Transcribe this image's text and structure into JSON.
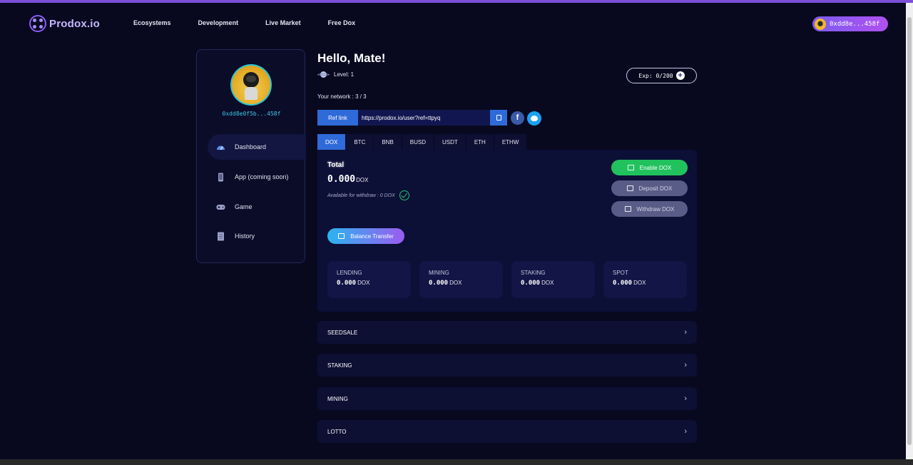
{
  "nav": {
    "logo_text": "Prodox.io",
    "links": [
      "Ecosystems",
      "Development",
      "Live Market",
      "Free Dox"
    ],
    "wallet_address": "0xdd8e...458f"
  },
  "sidebar": {
    "address": "0xdd8e0f5b...458f",
    "items": [
      {
        "label": "Dashboard",
        "icon": "gauge-icon"
      },
      {
        "label": "App (coming soon)",
        "icon": "phone-icon"
      },
      {
        "label": "Game",
        "icon": "gamepad-icon"
      },
      {
        "label": "History",
        "icon": "document-icon"
      }
    ]
  },
  "main": {
    "greeting": "Hello, Mate!",
    "level": "Level: 1",
    "exp": "Exp: 0/200",
    "network": "Your network : 3 / 3",
    "ref_label": "Ref link",
    "ref_value": "https://prodox.io/user?ref=ttpyq"
  },
  "tabs": [
    "DOX",
    "BTC",
    "BNB",
    "BUSD",
    "USDT",
    "ETH",
    "ETHW"
  ],
  "balance": {
    "total_label": "Total",
    "total_value": "0.000",
    "total_unit": "DOX",
    "available": "Available for withdraw :  0  DOX",
    "enable_label": "Enable DOX",
    "deposit_label": "Deposit DOX",
    "withdraw_label": "Withdraw DOX",
    "transfer_label": "Balance Transfer"
  },
  "stats": [
    {
      "name": "LENDING",
      "value": "0.000",
      "unit": "DOX"
    },
    {
      "name": "MINING",
      "value": "0.000",
      "unit": "DOX"
    },
    {
      "name": "STAKING",
      "value": "0.000",
      "unit": "DOX"
    },
    {
      "name": "SPOT",
      "value": "0.000",
      "unit": "DOX"
    }
  ],
  "sections": [
    "SEEDSALE",
    "STAKING",
    "MINING",
    "LOTTO"
  ],
  "colors": {
    "background": "#08091f",
    "accent_blue": "#2f6ad9",
    "accent_green": "#21c25e",
    "accent_purple": "#8b5cf6"
  }
}
